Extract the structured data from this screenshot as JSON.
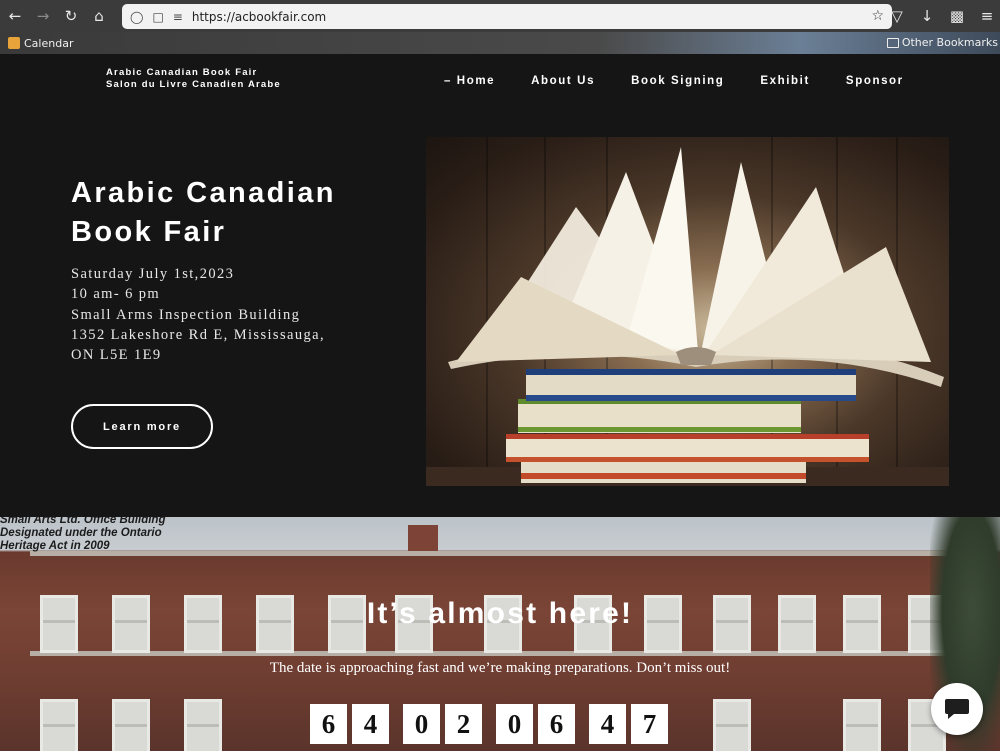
{
  "browser": {
    "url": "https://acbookfair.com",
    "bookmarks": {
      "left": "Calendar",
      "right": "Other Bookmarks"
    }
  },
  "site": {
    "brand_line1": "Arabic Canadian Book Fair",
    "brand_line2": "Salon du Livre Canadien Arabe",
    "nav": [
      "– Home",
      "About Us",
      "Book Signing",
      "Exhibit",
      "Sponsor"
    ]
  },
  "hero": {
    "title_line1": "Arabic Canadian",
    "title_line2": "Book Fair",
    "info": [
      "Saturday July 1st,2023",
      "10 am- 6 pm",
      "Small Arms Inspection Building",
      "1352 Lakeshore Rd E, Mississauga,",
      "ON L5E 1E9"
    ],
    "button": "Learn more"
  },
  "countdown": {
    "heritage": [
      "Small Arts Ltd. Office Building",
      "Designated under the Ontario",
      "Heritage Act in 2009"
    ],
    "heading": "It’s almost here!",
    "subheading": "The date is approaching fast and we’re making preparations. Don’t miss out!",
    "digits": [
      "6",
      "4",
      "0",
      "2",
      "0",
      "6",
      "4",
      "7"
    ]
  },
  "colors": {
    "background": "#151515",
    "text": "#ffffff",
    "brick": "#7a4536"
  }
}
